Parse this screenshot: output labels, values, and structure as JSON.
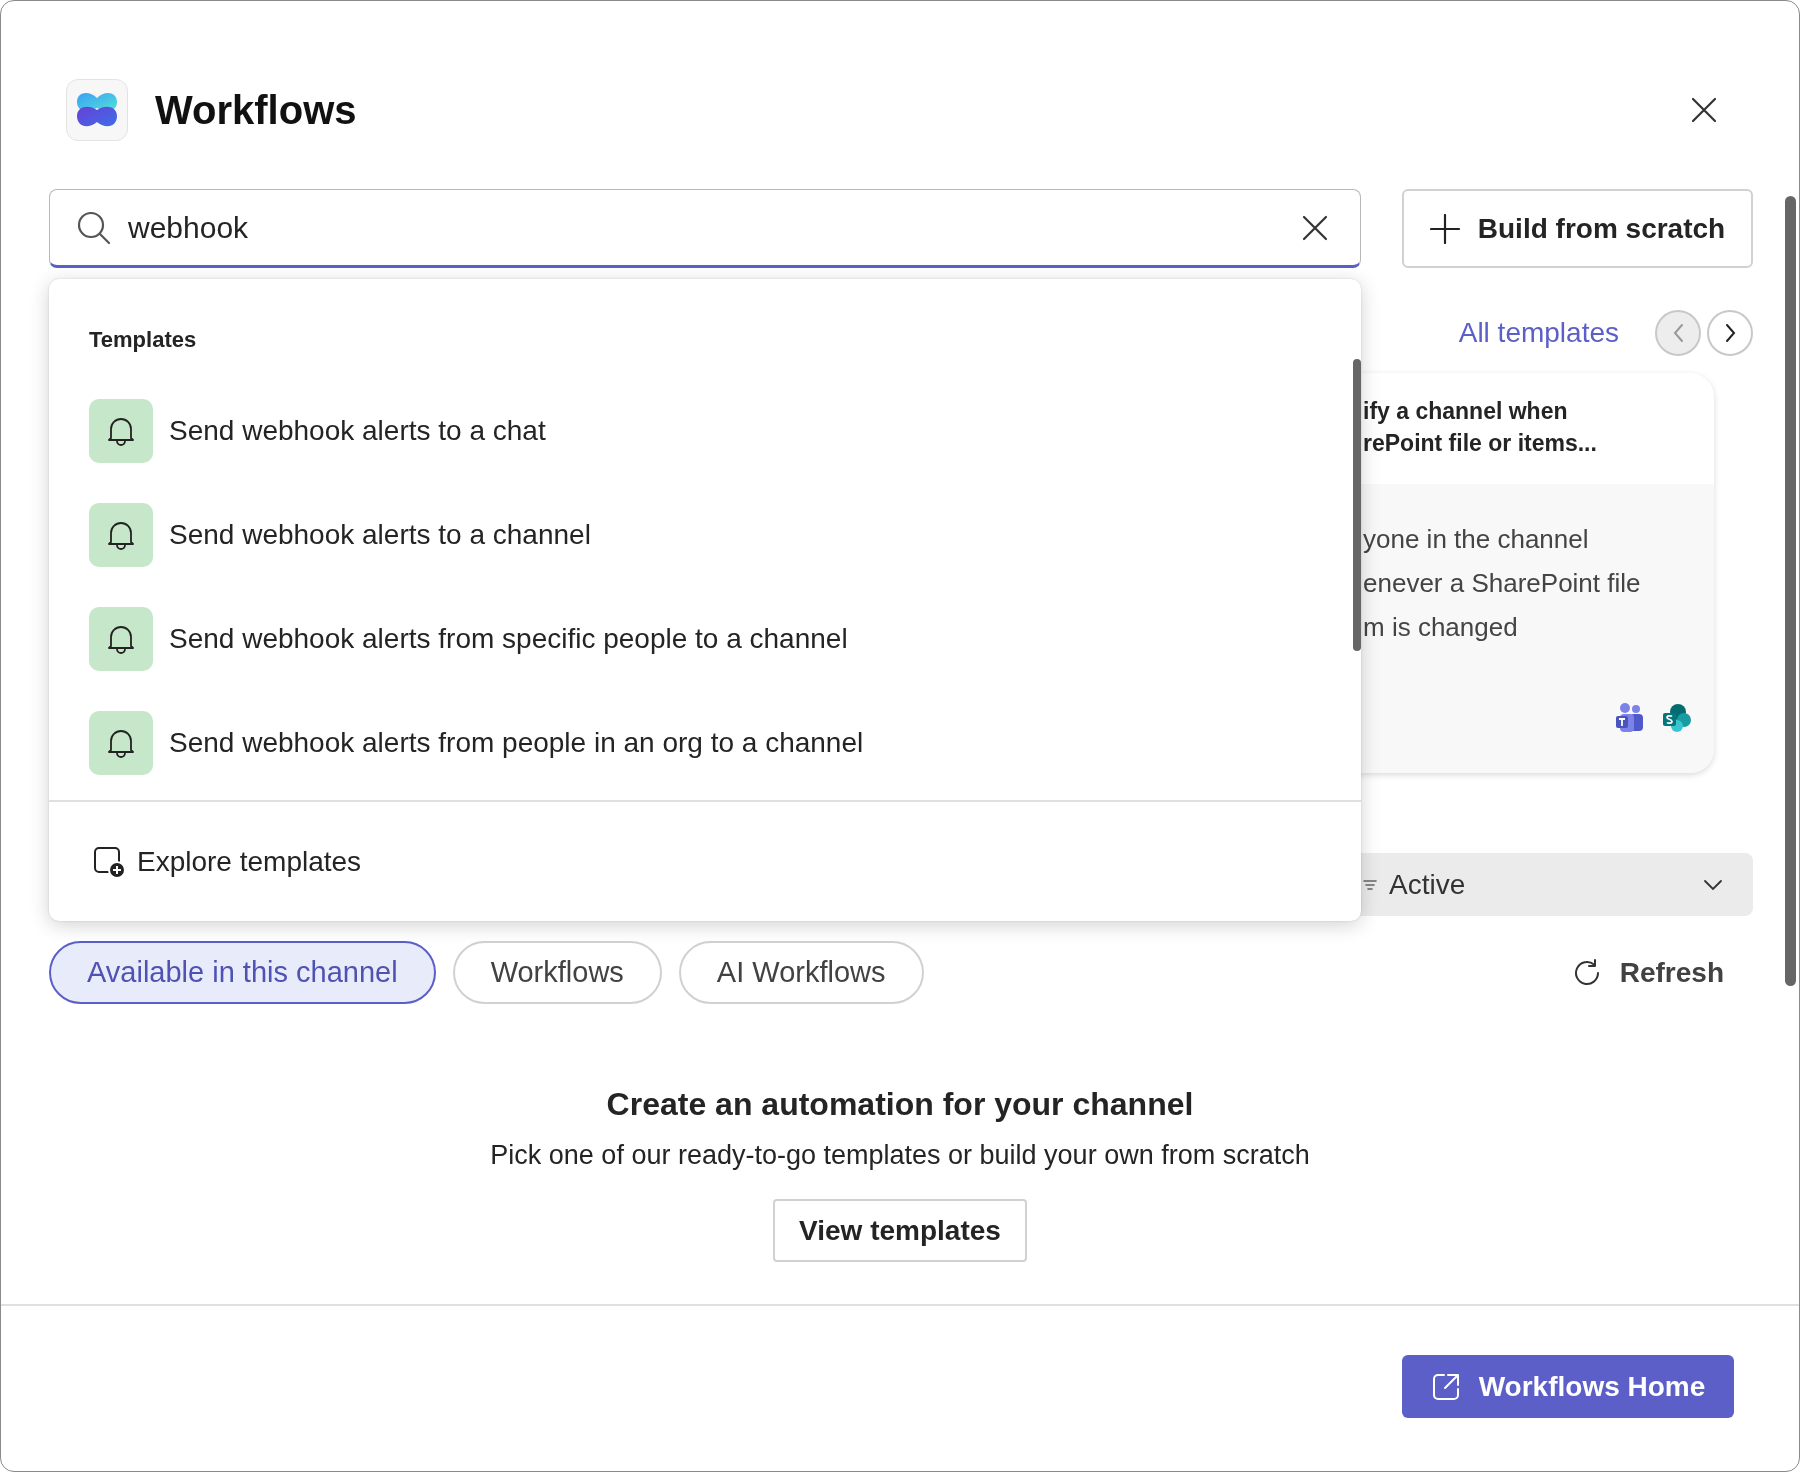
{
  "app": {
    "title": "Workflows"
  },
  "search": {
    "value": "webhook"
  },
  "build_button": {
    "label": "Build from scratch"
  },
  "dropdown": {
    "heading": "Templates",
    "items": [
      {
        "label": "Send webhook alerts to a chat"
      },
      {
        "label": "Send webhook alerts to a channel"
      },
      {
        "label": "Send webhook alerts from specific people to a channel"
      },
      {
        "label": "Send webhook alerts from people in an org to a channel"
      }
    ],
    "footer_link": "Explore templates"
  },
  "templates_section": {
    "link": "All templates",
    "nav": [
      {
        "kind": "prev",
        "disabled": true
      },
      {
        "kind": "next",
        "disabled": false
      }
    ]
  },
  "card": {
    "title_lines": [
      "ify a channel when",
      "rePoint file or items..."
    ],
    "description_lines": [
      "yone in the channel",
      "enever a SharePoint file",
      "m is changed"
    ]
  },
  "status_filter": {
    "value": "Active"
  },
  "filter_tabs": [
    {
      "label": "Available in this channel",
      "selected": true
    },
    {
      "label": "Workflows",
      "selected": false
    },
    {
      "label": "AI Workflows",
      "selected": false
    }
  ],
  "refresh": {
    "label": "Refresh"
  },
  "empty_state": {
    "heading": "Create an automation for your channel",
    "text": "Pick one of our ready-to-go templates or build your own from scratch",
    "button": "View templates"
  },
  "footer": {
    "button": "Workflows Home"
  }
}
